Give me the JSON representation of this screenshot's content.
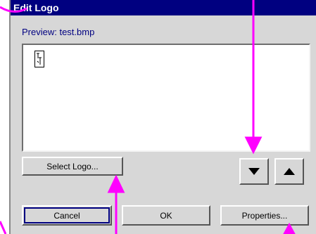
{
  "window": {
    "title": "Edit Logo"
  },
  "preview": {
    "label": "Preview: test.bmp"
  },
  "buttons": {
    "select_logo": "Select Logo...",
    "cancel": "Cancel",
    "ok": "OK",
    "properties": "Properties..."
  },
  "icons": {
    "down": "arrow-down-icon",
    "up": "arrow-up-icon"
  },
  "colors": {
    "title_bar": "#000080",
    "annotation_arrow": "#ff00ff",
    "dialog_bg": "#d7d7d7"
  }
}
